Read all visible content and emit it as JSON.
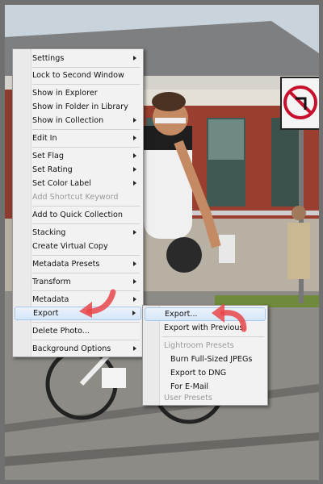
{
  "menu": {
    "items": [
      {
        "label": "Settings",
        "submenu": true
      },
      {
        "label": "Lock to Second Window"
      },
      {
        "label": "Show in Explorer"
      },
      {
        "label": "Show in Folder in Library"
      },
      {
        "label": "Show in Collection",
        "submenu": true
      },
      {
        "label": "Edit In",
        "submenu": true
      },
      {
        "label": "Set Flag",
        "submenu": true
      },
      {
        "label": "Set Rating",
        "submenu": true
      },
      {
        "label": "Set Color Label",
        "submenu": true
      },
      {
        "label": "Add Shortcut Keyword",
        "disabled": true
      },
      {
        "label": "Add to Quick Collection"
      },
      {
        "label": "Stacking",
        "submenu": true
      },
      {
        "label": "Create Virtual Copy"
      },
      {
        "label": "Metadata Presets",
        "submenu": true
      },
      {
        "label": "Transform",
        "submenu": true
      },
      {
        "label": "Metadata",
        "submenu": true
      },
      {
        "label": "Export",
        "submenu": true,
        "highlighted": true
      },
      {
        "label": "Delete Photo..."
      },
      {
        "label": "Background Options",
        "submenu": true
      }
    ]
  },
  "export_submenu": {
    "items": [
      {
        "label": "Export...",
        "highlighted": true
      },
      {
        "label": "Export with Previous"
      },
      {
        "label": "Lightroom Presets",
        "header": true
      },
      {
        "label": "Burn Full-Sized JPEGs"
      },
      {
        "label": "Export to DNG"
      },
      {
        "label": "For E-Mail"
      },
      {
        "label": "User Presets",
        "header": true
      }
    ]
  },
  "sign": {
    "color": "#c8102e"
  },
  "accent_arrow_color": "#e8474a"
}
